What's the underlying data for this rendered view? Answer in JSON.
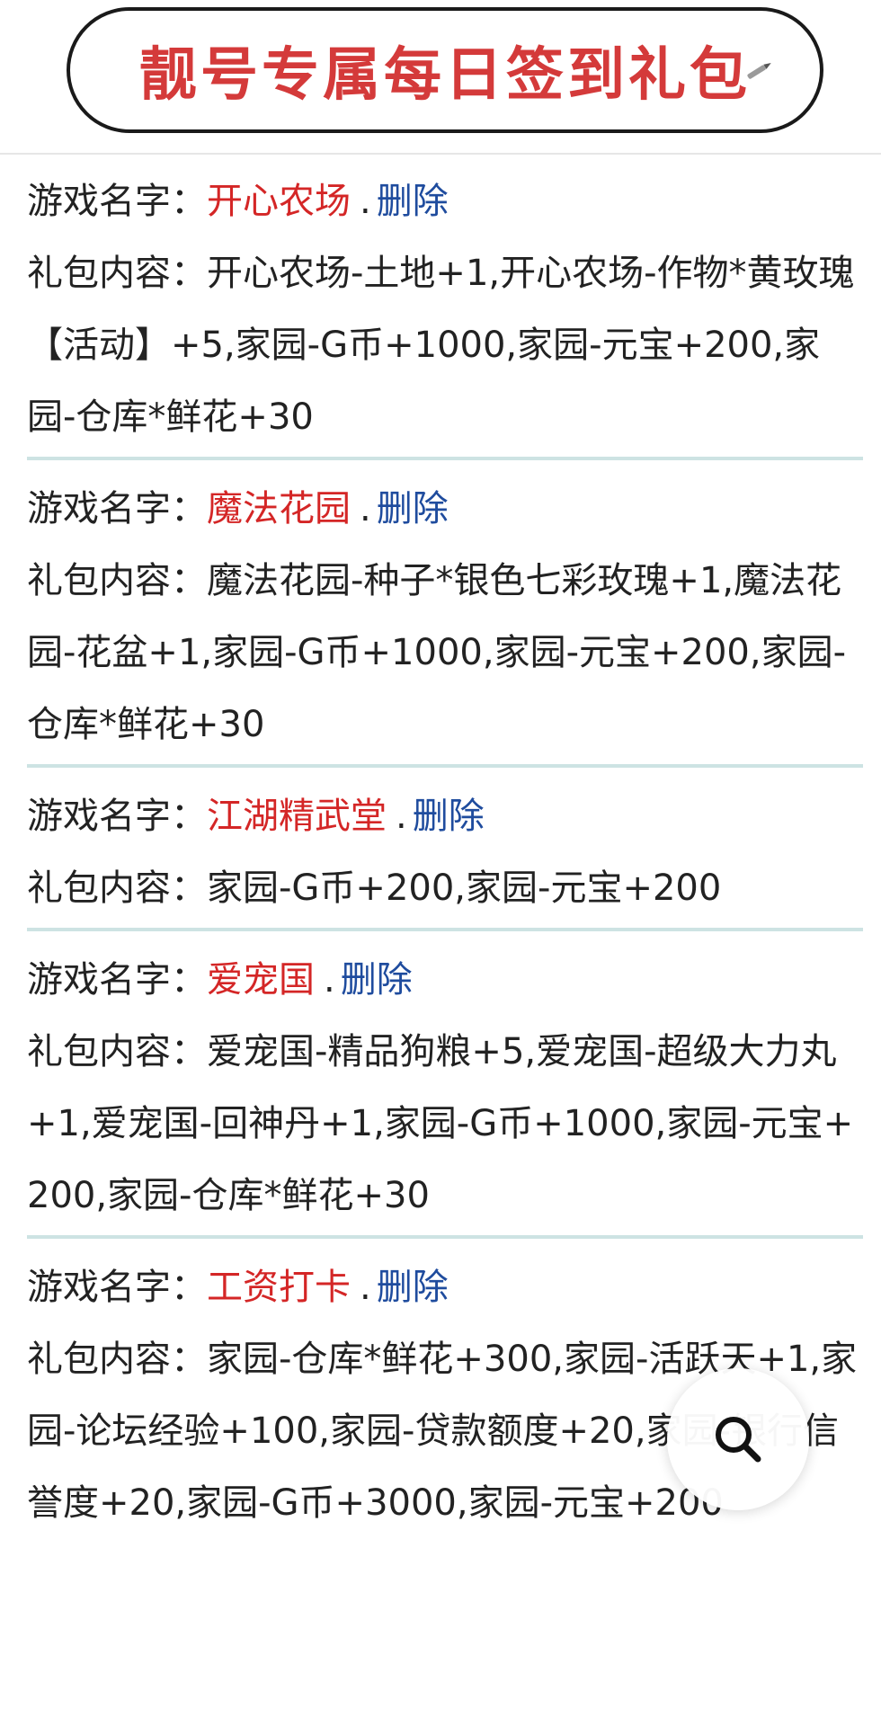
{
  "header": {
    "title": "靓号专属每日签到礼包"
  },
  "labels": {
    "game_name": "游戏名字：",
    "gift_content": "礼包内容：",
    "separator": ".",
    "delete": "删除"
  },
  "entries": [
    {
      "game": "开心农场",
      "content": "开心农场-土地+1,开心农场-作物*黄玫瑰【活动】+5,家园-G币+1000,家园-元宝+200,家园-仓库*鲜花+30"
    },
    {
      "game": "魔法花园",
      "content": "魔法花园-种子*银色七彩玫瑰+1,魔法花园-花盆+1,家园-G币+1000,家园-元宝+200,家园-仓库*鲜花+30"
    },
    {
      "game": "江湖精武堂",
      "content": "家园-G币+200,家园-元宝+200"
    },
    {
      "game": "爱宠国",
      "content": "爱宠国-精品狗粮+5,爱宠国-超级大力丸+1,爱宠国-回神丹+1,家园-G币+1000,家园-元宝+200,家园-仓库*鲜花+30"
    },
    {
      "game": "工资打卡",
      "content": "家园-仓库*鲜花+300,家园-活跃天+1,家园-论坛经验+100,家园-贷款额度+20,家园-银行信誉度+20,家园-G币+3000,家园-元宝+200"
    }
  ],
  "icons": {
    "search": "search-icon",
    "edit": "pencil-icon"
  },
  "colors": {
    "title": "#d43a3a",
    "game_name": "#d42626",
    "delete_link": "#1f4c9e",
    "divider": "#cde3e3"
  }
}
